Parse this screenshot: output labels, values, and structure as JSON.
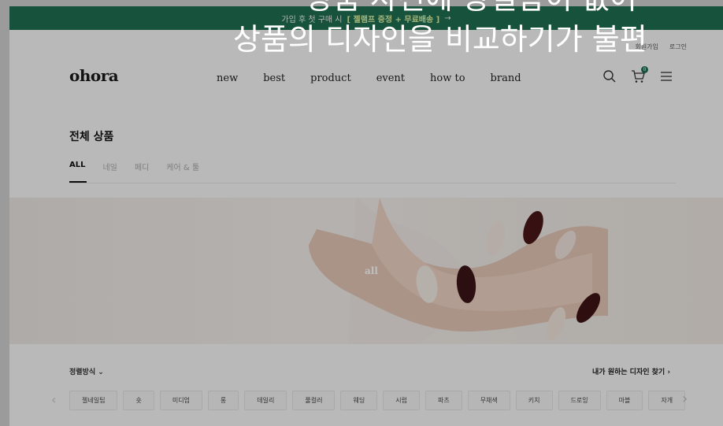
{
  "promo": {
    "text": "가입 후 첫 구매 시",
    "highlight": "[ 젤램프 증정 + 무료배송 ]",
    "arrow": "→"
  },
  "util": {
    "items": [
      "회원가입",
      "로그인"
    ]
  },
  "header": {
    "logo": "ohora",
    "nav": [
      "new",
      "best",
      "product",
      "event",
      "how to",
      "brand"
    ],
    "cart_count": "0",
    "icons": [
      "search-icon",
      "cart-icon",
      "menu-icon"
    ]
  },
  "page": {
    "title": "전체 상품",
    "tabs": [
      {
        "label": "ALL",
        "active": true
      },
      {
        "label": "네일",
        "active": false
      },
      {
        "label": "페디",
        "active": false
      },
      {
        "label": "케어 & 툴",
        "active": false
      }
    ]
  },
  "banner": {
    "label": "all"
  },
  "filters": {
    "sort_label": "정렬방식",
    "sort_caret": "⌄",
    "find_design": "내가 원하는 디자인 찾기",
    "find_caret": "›",
    "chips": [
      "젤네일팁",
      "숏",
      "미디엄",
      "롱",
      "데일리",
      "풀컬러",
      "웨딩",
      "시럽",
      "파츠",
      "무채색",
      "키치",
      "드로잉",
      "마블",
      "자개"
    ],
    "prev": "‹",
    "next": "›"
  },
  "caption": {
    "line1": "상품 사진에 광일함이 없어",
    "line2": "상품의 디자인을 비교하기가 불편"
  },
  "colors": {
    "brand_green": "#1f6e50",
    "highlight": "#d9f0a3"
  }
}
